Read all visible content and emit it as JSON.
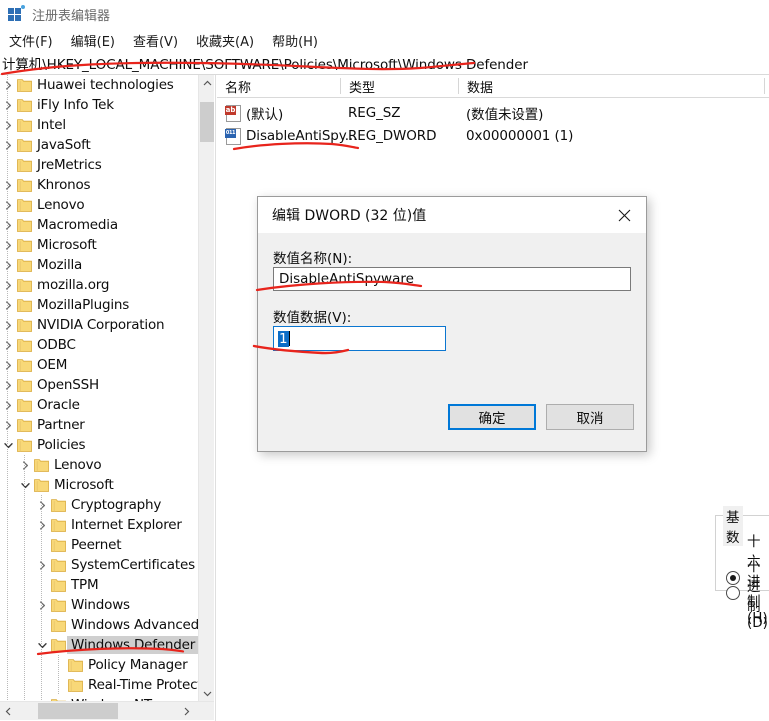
{
  "window": {
    "title": "注册表编辑器",
    "icon": "registry-editor-icon"
  },
  "menubar": {
    "items": [
      {
        "label": "文件(F)",
        "name": "menu-file"
      },
      {
        "label": "编辑(E)",
        "name": "menu-edit"
      },
      {
        "label": "查看(V)",
        "name": "menu-view"
      },
      {
        "label": "收藏夹(A)",
        "name": "menu-favorites"
      },
      {
        "label": "帮助(H)",
        "name": "menu-help"
      }
    ]
  },
  "address": {
    "path": "计算机\\HKEY_LOCAL_MACHINE\\SOFTWARE\\Policies\\Microsoft\\Windows Defender"
  },
  "tree": {
    "items": [
      {
        "label": "Huawei technologies",
        "depth": 0,
        "twist": "collapsed",
        "selected": false
      },
      {
        "label": "iFly Info Tek",
        "depth": 0,
        "twist": "collapsed",
        "selected": false
      },
      {
        "label": "Intel",
        "depth": 0,
        "twist": "collapsed",
        "selected": false
      },
      {
        "label": "JavaSoft",
        "depth": 0,
        "twist": "collapsed",
        "selected": false
      },
      {
        "label": "JreMetrics",
        "depth": 0,
        "twist": "leaf",
        "selected": false
      },
      {
        "label": "Khronos",
        "depth": 0,
        "twist": "collapsed",
        "selected": false
      },
      {
        "label": "Lenovo",
        "depth": 0,
        "twist": "collapsed",
        "selected": false
      },
      {
        "label": "Macromedia",
        "depth": 0,
        "twist": "collapsed",
        "selected": false
      },
      {
        "label": "Microsoft",
        "depth": 0,
        "twist": "collapsed",
        "selected": false
      },
      {
        "label": "Mozilla",
        "depth": 0,
        "twist": "collapsed",
        "selected": false
      },
      {
        "label": "mozilla.org",
        "depth": 0,
        "twist": "collapsed",
        "selected": false
      },
      {
        "label": "MozillaPlugins",
        "depth": 0,
        "twist": "collapsed",
        "selected": false
      },
      {
        "label": "NVIDIA Corporation",
        "depth": 0,
        "twist": "collapsed",
        "selected": false
      },
      {
        "label": "ODBC",
        "depth": 0,
        "twist": "collapsed",
        "selected": false
      },
      {
        "label": "OEM",
        "depth": 0,
        "twist": "collapsed",
        "selected": false
      },
      {
        "label": "OpenSSH",
        "depth": 0,
        "twist": "collapsed",
        "selected": false
      },
      {
        "label": "Oracle",
        "depth": 0,
        "twist": "collapsed",
        "selected": false
      },
      {
        "label": "Partner",
        "depth": 0,
        "twist": "collapsed",
        "selected": false
      },
      {
        "label": "Policies",
        "depth": 0,
        "twist": "expanded",
        "selected": false
      },
      {
        "label": "Lenovo",
        "depth": 1,
        "twist": "collapsed",
        "selected": false
      },
      {
        "label": "Microsoft",
        "depth": 1,
        "twist": "expanded",
        "selected": false
      },
      {
        "label": "Cryptography",
        "depth": 2,
        "twist": "collapsed",
        "selected": false
      },
      {
        "label": "Internet Explorer",
        "depth": 2,
        "twist": "collapsed",
        "selected": false
      },
      {
        "label": "Peernet",
        "depth": 2,
        "twist": "leaf",
        "selected": false
      },
      {
        "label": "SystemCertificates",
        "depth": 2,
        "twist": "collapsed",
        "selected": false
      },
      {
        "label": "TPM",
        "depth": 2,
        "twist": "leaf",
        "selected": false
      },
      {
        "label": "Windows",
        "depth": 2,
        "twist": "collapsed",
        "selected": false
      },
      {
        "label": "Windows Advanced Th",
        "depth": 2,
        "twist": "leaf",
        "selected": false
      },
      {
        "label": "Windows Defender",
        "depth": 2,
        "twist": "expanded",
        "selected": true
      },
      {
        "label": "Policy Manager",
        "depth": 3,
        "twist": "leaf",
        "selected": false
      },
      {
        "label": "Real-Time Protectio",
        "depth": 3,
        "twist": "leaf",
        "selected": false
      },
      {
        "label": "Windows NT",
        "depth": 2,
        "twist": "collapsed",
        "selected": false
      }
    ]
  },
  "list": {
    "columns": [
      "名称",
      "类型",
      "数据"
    ],
    "rows": [
      {
        "icon": "string-value-icon",
        "icon_badge": "ab",
        "icon_kind": "sz",
        "name": "(默认)",
        "type": "REG_SZ",
        "data": "(数值未设置)"
      },
      {
        "icon": "dword-value-icon",
        "icon_badge": "011",
        "icon_kind": "dw",
        "name": "DisableAntiSpy...",
        "type": "REG_DWORD",
        "data": "0x00000001 (1)"
      }
    ]
  },
  "dialog": {
    "title": "编辑 DWORD (32 位)值",
    "close_icon": "close-icon",
    "name_label": "数值名称(N):",
    "name_value": "DisableAntiSpyware",
    "data_label": "数值数据(V):",
    "data_value": "1",
    "base_legend": "基数",
    "base_options": [
      {
        "label": "十六进制(H)",
        "selected": true
      },
      {
        "label": "十进制(D)",
        "selected": false
      }
    ],
    "ok_label": "确定",
    "cancel_label": "取消"
  },
  "scroll": {
    "up_arrow": "chevron-up-icon",
    "down_arrow": "chevron-down-icon",
    "left_arrow": "chevron-left-icon",
    "right_arrow": "chevron-right-icon"
  },
  "colors": {
    "accent": "#0078d7",
    "selection": "#0b6dc7",
    "folder": "#f8d878",
    "annotation": "#e8241c",
    "tree_selection": "#cfcfcf"
  },
  "annotations": [
    {
      "name": "ink-address-underline"
    },
    {
      "name": "ink-value-name-underline"
    },
    {
      "name": "ink-dialog-name-underline"
    },
    {
      "name": "ink-dialog-data-underline"
    },
    {
      "name": "ink-tree-defender-underline"
    }
  ]
}
